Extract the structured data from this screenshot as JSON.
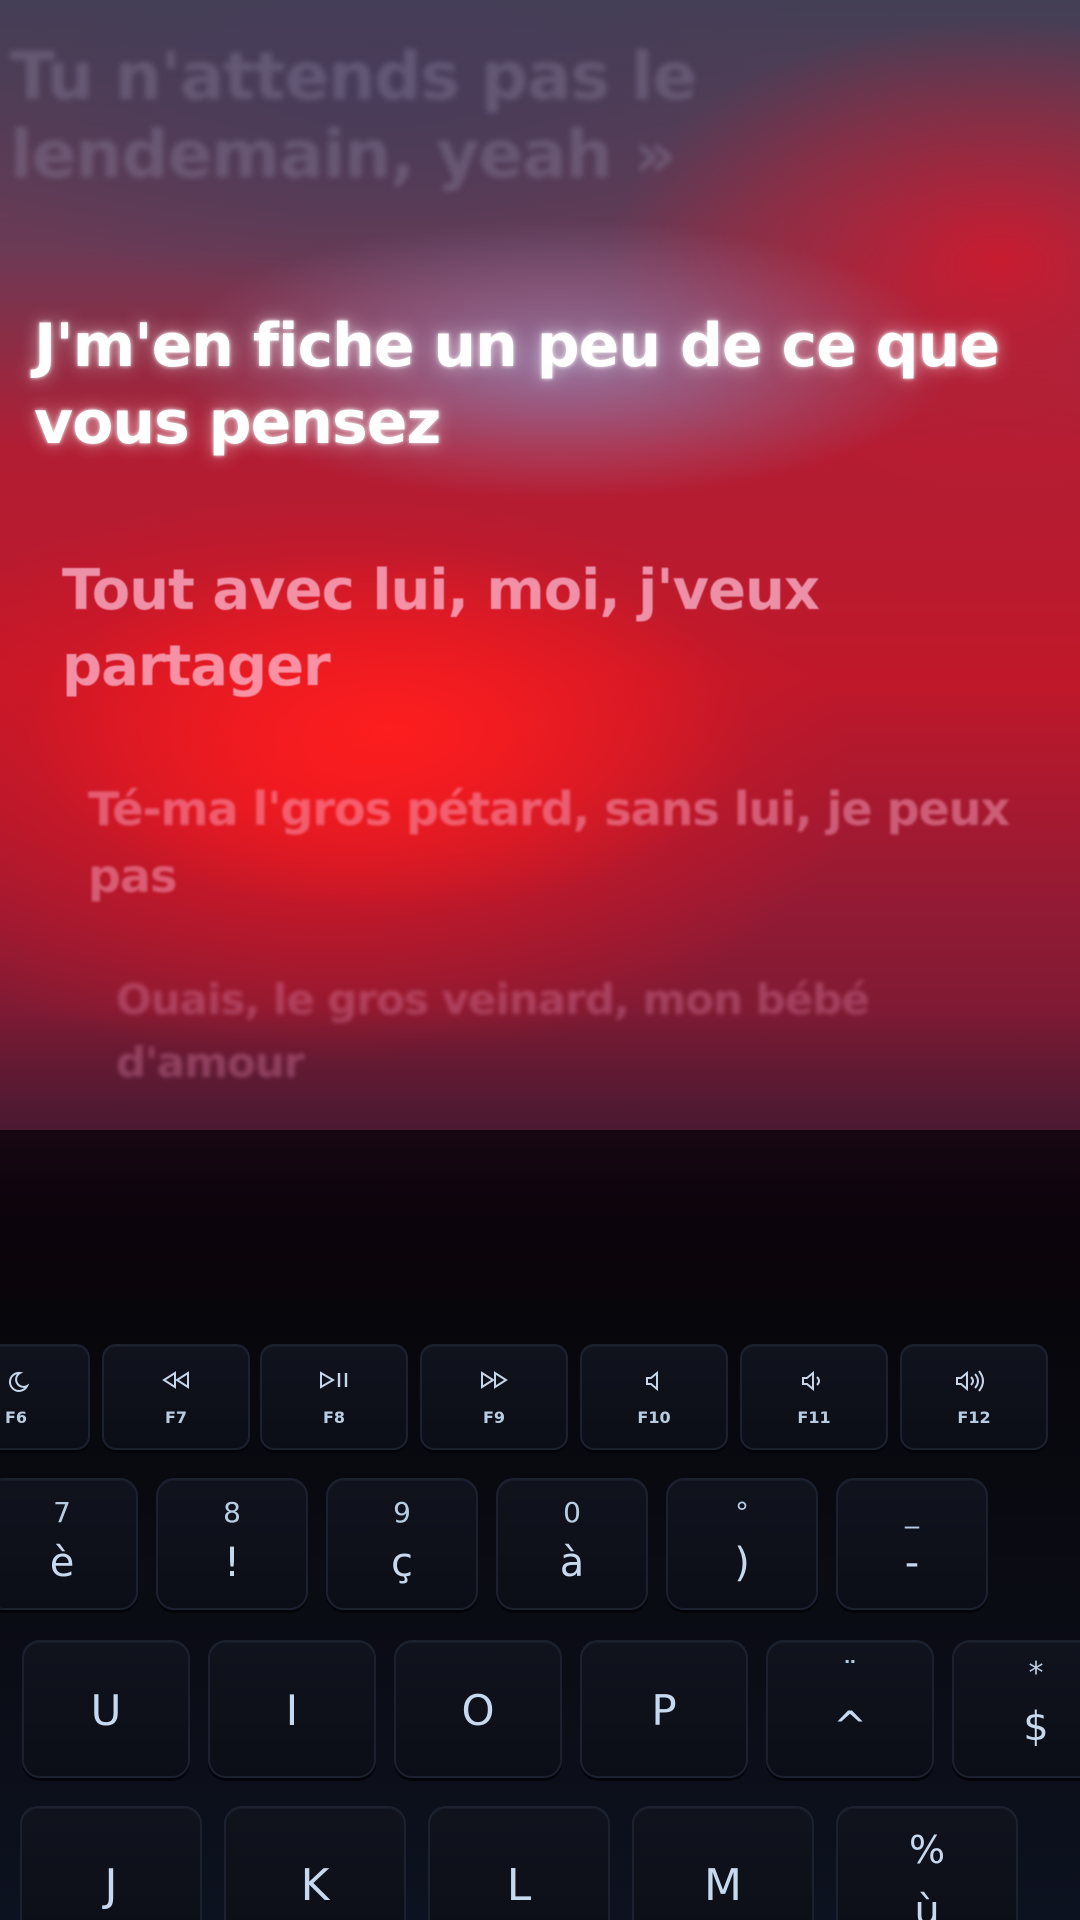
{
  "lyrics": {
    "previous": "Tu n'attends pas le lendemain, yeah »",
    "current": "J'm'en fiche un peu de ce que vous pensez",
    "next": [
      "Tout avec lui, moi, j'veux partager",
      "Té-ma l'gros pétard, sans lui, je peux pas",
      "Ouais, le gros veinard, mon bébé d'amour"
    ]
  },
  "keyboard": {
    "function_row": [
      {
        "label": "F6",
        "icon": "moon-icon"
      },
      {
        "label": "F7",
        "icon": "rewind-icon"
      },
      {
        "label": "F8",
        "icon": "play-pause-icon"
      },
      {
        "label": "F9",
        "icon": "fast-forward-icon"
      },
      {
        "label": "F10",
        "icon": "mute-icon"
      },
      {
        "label": "F11",
        "icon": "volume-down-icon"
      },
      {
        "label": "F12",
        "icon": "volume-up-icon"
      }
    ],
    "number_row": [
      {
        "top": "7",
        "bottom": "è"
      },
      {
        "top": "8",
        "bottom": "!"
      },
      {
        "top": "9",
        "bottom": "ç"
      },
      {
        "top": "0",
        "bottom": "à"
      },
      {
        "top": "°",
        "bottom": ")"
      },
      {
        "top": "_",
        "bottom": "-"
      }
    ],
    "alpha_row": [
      {
        "label": "U"
      },
      {
        "label": "I"
      },
      {
        "label": "O"
      },
      {
        "label": "P"
      },
      {
        "top": "¨",
        "bottom": "^"
      },
      {
        "top": "*",
        "bottom": "$"
      }
    ],
    "home_row": [
      {
        "label": "J"
      },
      {
        "label": "K"
      },
      {
        "label": "L"
      },
      {
        "label": "M"
      },
      {
        "top": "%",
        "bottom": "ù"
      }
    ]
  },
  "colors": {
    "screen_red": "#c0182a",
    "key_legend": "#b9cde2",
    "key_face": "#0e1019"
  }
}
